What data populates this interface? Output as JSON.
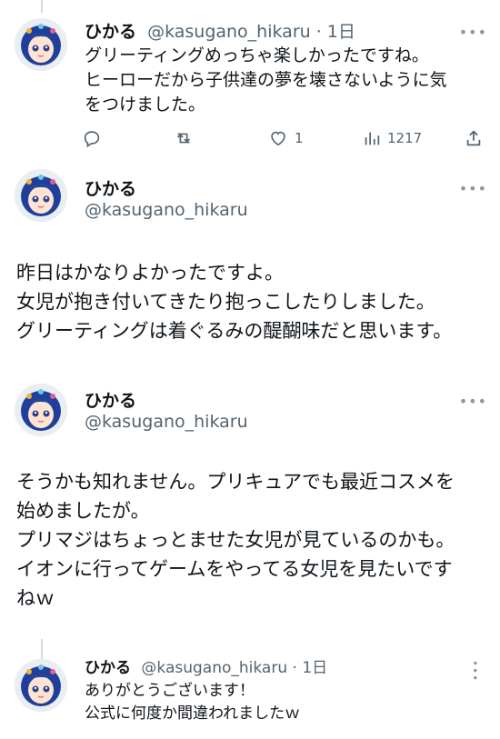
{
  "tweets": [
    {
      "name": "ひかる",
      "handle": "@kasugano_hikaru",
      "time": "1日",
      "text": "グリーティングめっちゃ楽しかったですね。\nヒーローだから子供達の夢を壊さないように気\nをつけました。",
      "replies": "",
      "retweets": "",
      "likes": "1",
      "views": "1217"
    },
    {
      "name": "ひかる",
      "handle": "@kasugano_hikaru",
      "text": "昨日はかなりよかったですよ。\n女児が抱き付いてきたり抱っこしたりしました。\nグリーティングは着ぐるみの醍醐味だと思います。"
    },
    {
      "name": "ひかる",
      "handle": "@kasugano_hikaru",
      "text": "そうかも知れません。プリキュアでも最近コスメを\n始めましたが。\nプリマジはちょっとませた女児が見ているのかも。\nイオンに行ってゲームをやってる女児を見たいです\nねｗ"
    },
    {
      "name": "ひかる",
      "handle": "@kasugano_hikaru",
      "time": "1日",
      "text": "ありがとうございます！\n公式に何度か間違われましたｗ"
    }
  ],
  "icons": {
    "reply": "reply-icon",
    "retweet": "retweet-icon",
    "like": "heart-icon",
    "views": "views-icon",
    "share": "share-icon",
    "more": "more-icon"
  },
  "separator": " · "
}
